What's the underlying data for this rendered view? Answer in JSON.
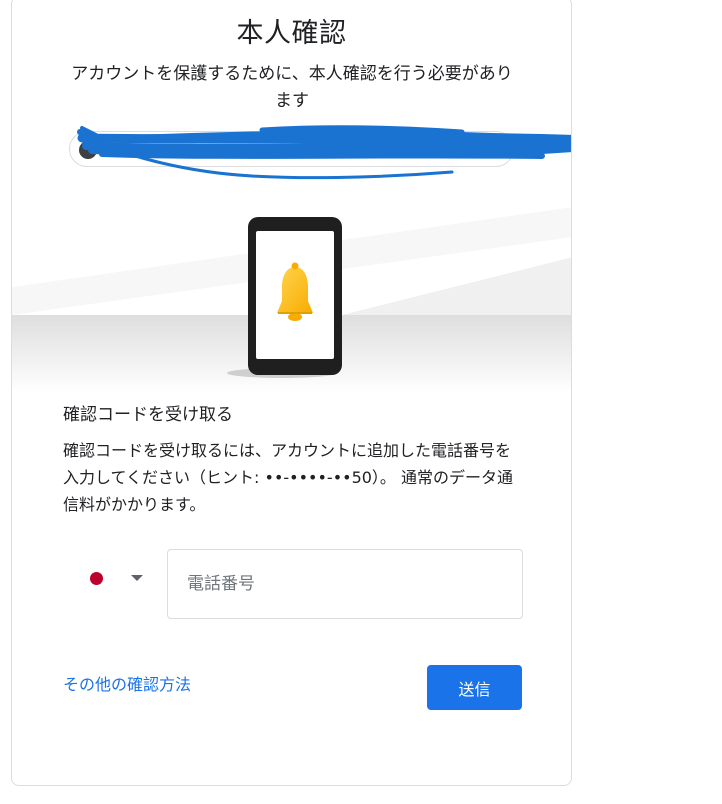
{
  "header": {
    "title": "本人確認",
    "subtitle": "アカウントを保護するために、本人確認を行う必要があります"
  },
  "account": {
    "email_redacted": true
  },
  "illustration": {
    "icon": "phone-with-bell-icon"
  },
  "verification": {
    "heading": "確認コードを受け取る",
    "body": "確認コードを受け取るには、アカウントに追加した電話番号を入力してください（ヒント: ••-••••-••50）。 通常のデータ通信料がかかります。"
  },
  "form": {
    "country_flag": "japan-flag-icon",
    "phone_placeholder": "電話番号",
    "phone_value": ""
  },
  "actions": {
    "other_methods_label": "その他の確認方法",
    "send_label": "送信"
  },
  "colors": {
    "accent": "#1a73e8",
    "bell": "#fbbc04",
    "flag_red": "#bc002d",
    "scribble": "#1a73d1"
  }
}
